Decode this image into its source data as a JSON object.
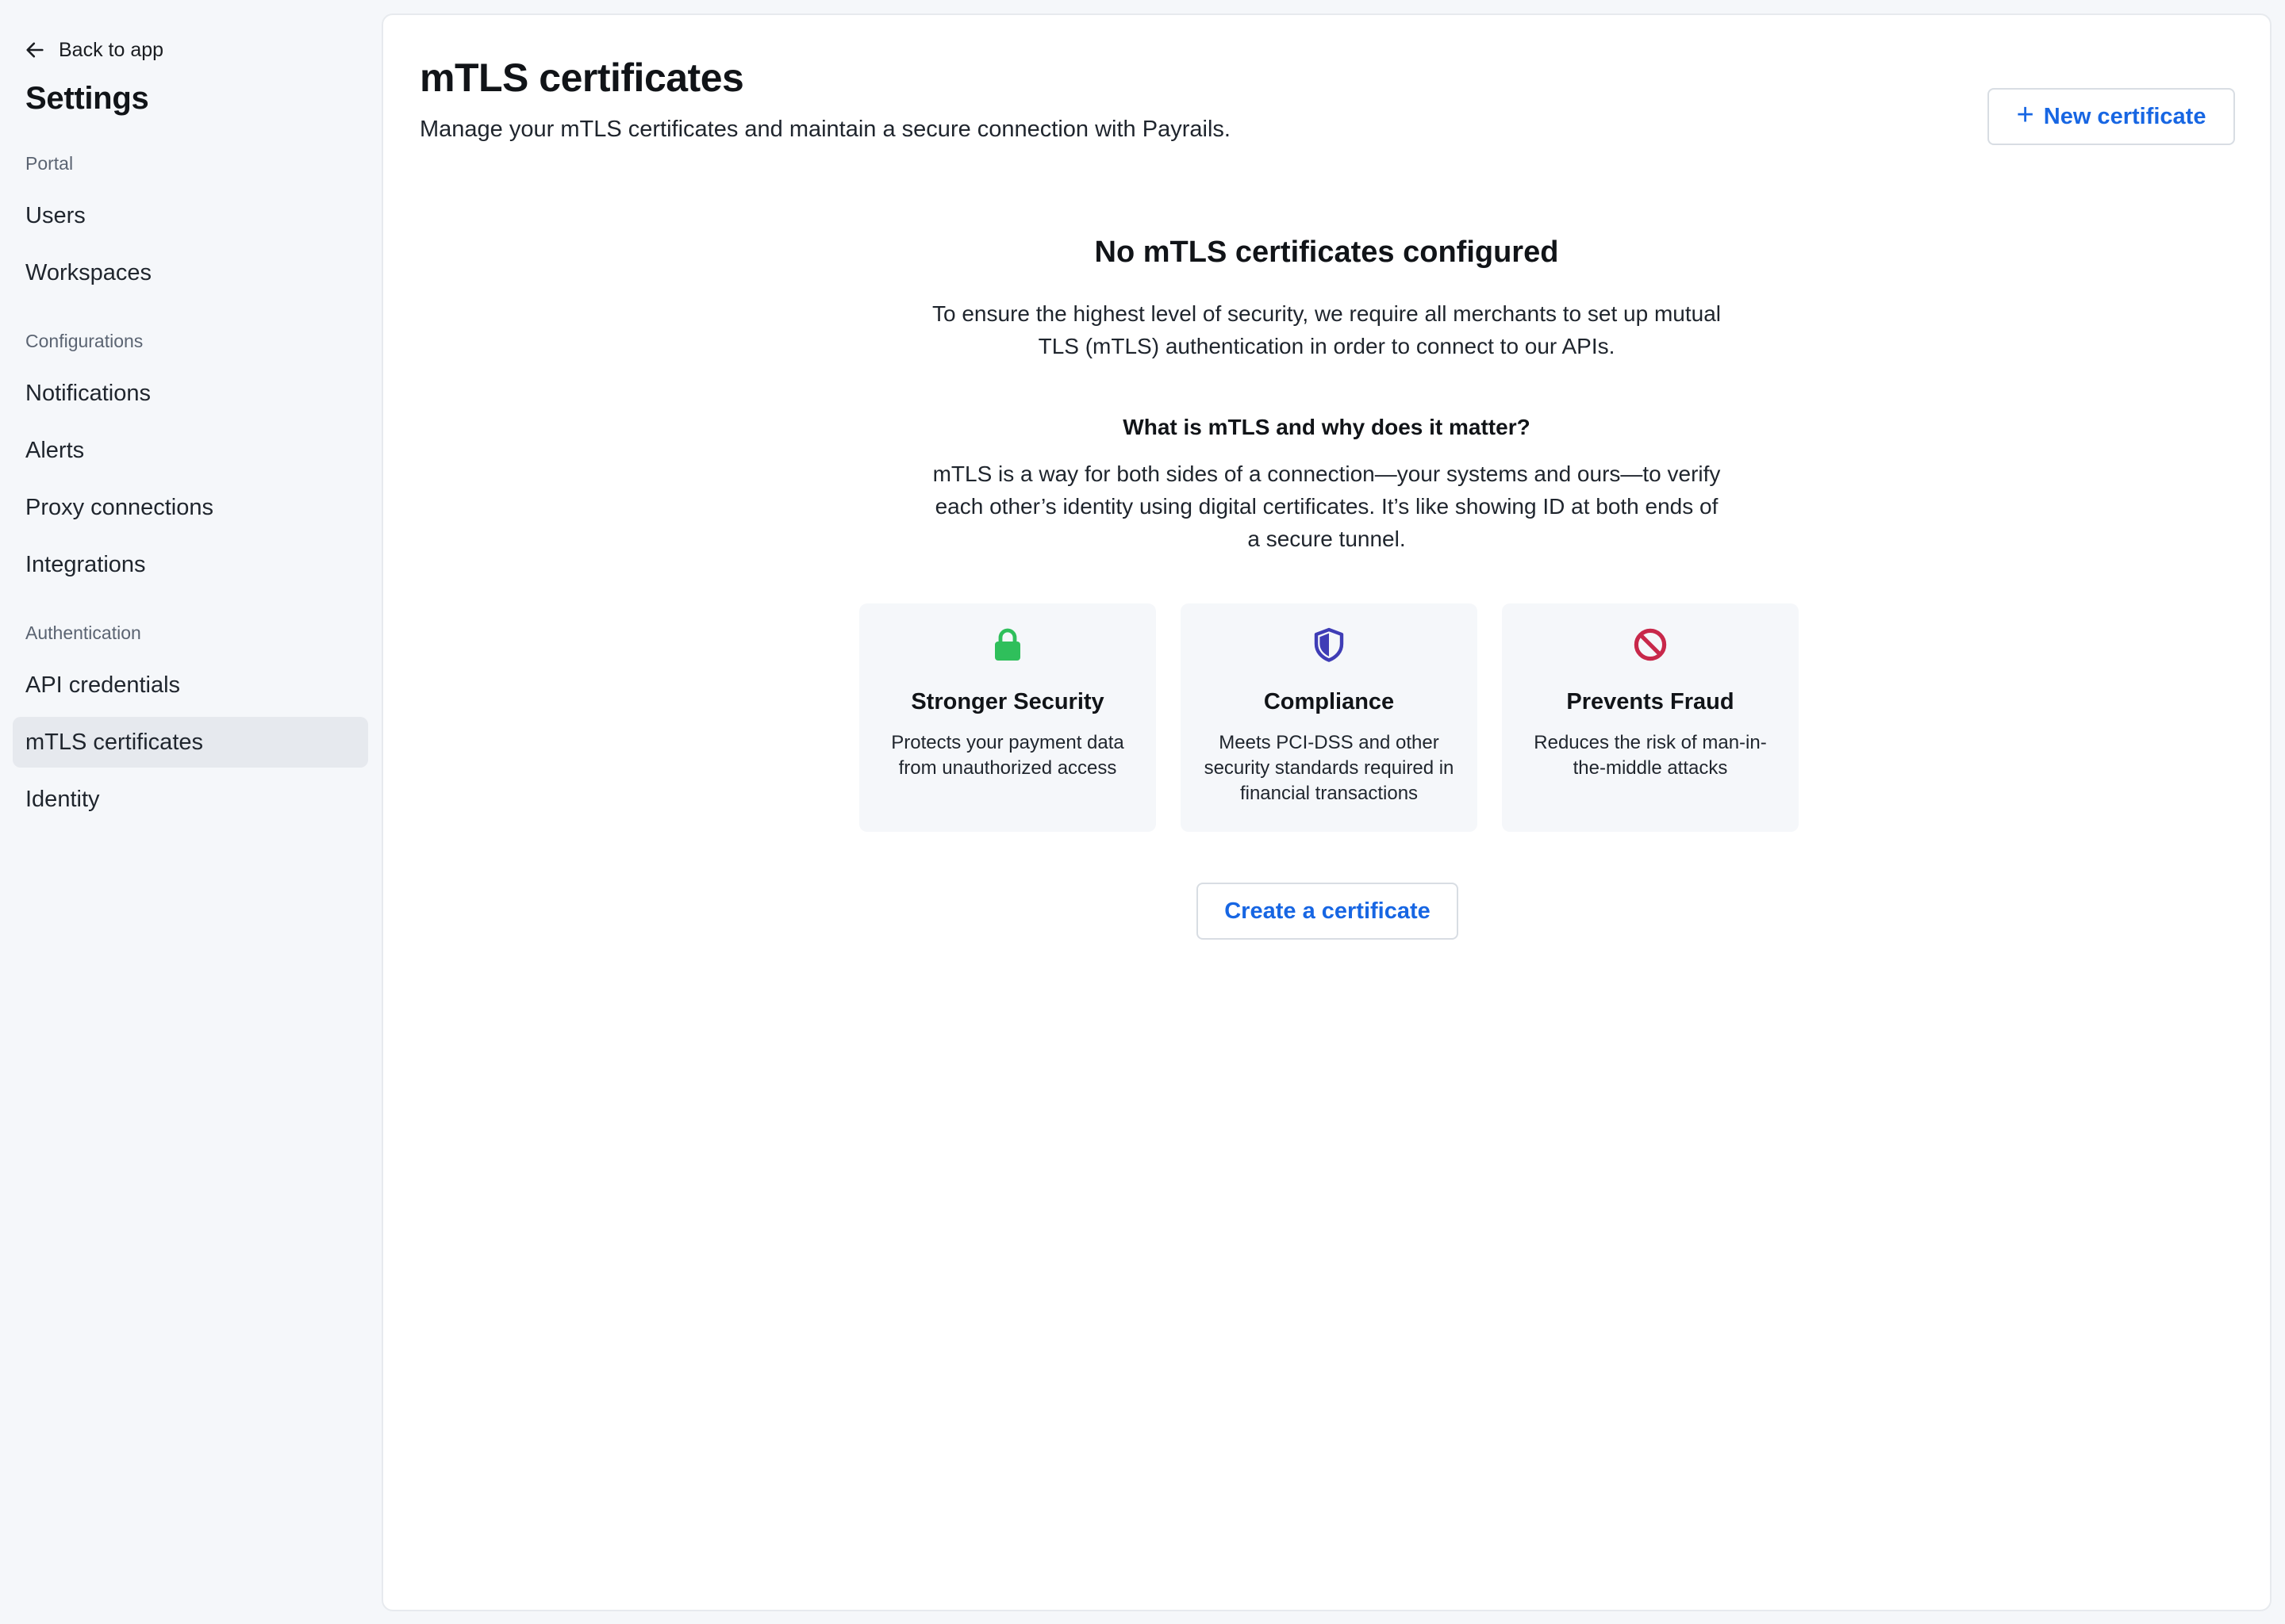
{
  "sidebar": {
    "back_label": "Back to app",
    "title": "Settings",
    "sections": [
      {
        "label": "Portal",
        "items": [
          "Users",
          "Workspaces"
        ]
      },
      {
        "label": "Configurations",
        "items": [
          "Notifications",
          "Alerts",
          "Proxy connections",
          "Integrations"
        ]
      },
      {
        "label": "Authentication",
        "items": [
          "API credentials",
          "mTLS certificates",
          "Identity"
        ]
      }
    ],
    "active_item": "mTLS certificates"
  },
  "header": {
    "title": "mTLS certificates",
    "subtitle": "Manage your mTLS certificates and maintain a secure connection with Payrails.",
    "new_button_label": "New certificate"
  },
  "empty_state": {
    "title": "No mTLS certificates configured",
    "description": "To ensure the highest level of security, we require all merchants to set up mutual TLS (mTLS) authentication in order to connect to our APIs.",
    "what_title": "What is mTLS and why does it matter?",
    "what_description": "mTLS is a way for both sides of a connection—your systems and ours—to verify each other’s identity using digital certificates. It’s like showing ID at both ends of a secure tunnel.",
    "cards": [
      {
        "icon": "lock-icon",
        "title": "Stronger Security",
        "description": "Protects your payment data from unauthorized access"
      },
      {
        "icon": "shield-icon",
        "title": "Compliance",
        "description": "Meets PCI-DSS and other security standards required in financial transactions"
      },
      {
        "icon": "prohibited-icon",
        "title": "Prevents Fraud",
        "description": "Reduces the risk of man-in-the-middle attacks"
      }
    ],
    "create_button_label": "Create a certificate"
  },
  "colors": {
    "accent": "#1766e3",
    "lock": "#2fbf5b",
    "shield": "#3f3db6",
    "prohibited": "#c8284a",
    "sidebar_bg": "#f5f7fa",
    "active_item_bg": "#e6e9ee"
  }
}
